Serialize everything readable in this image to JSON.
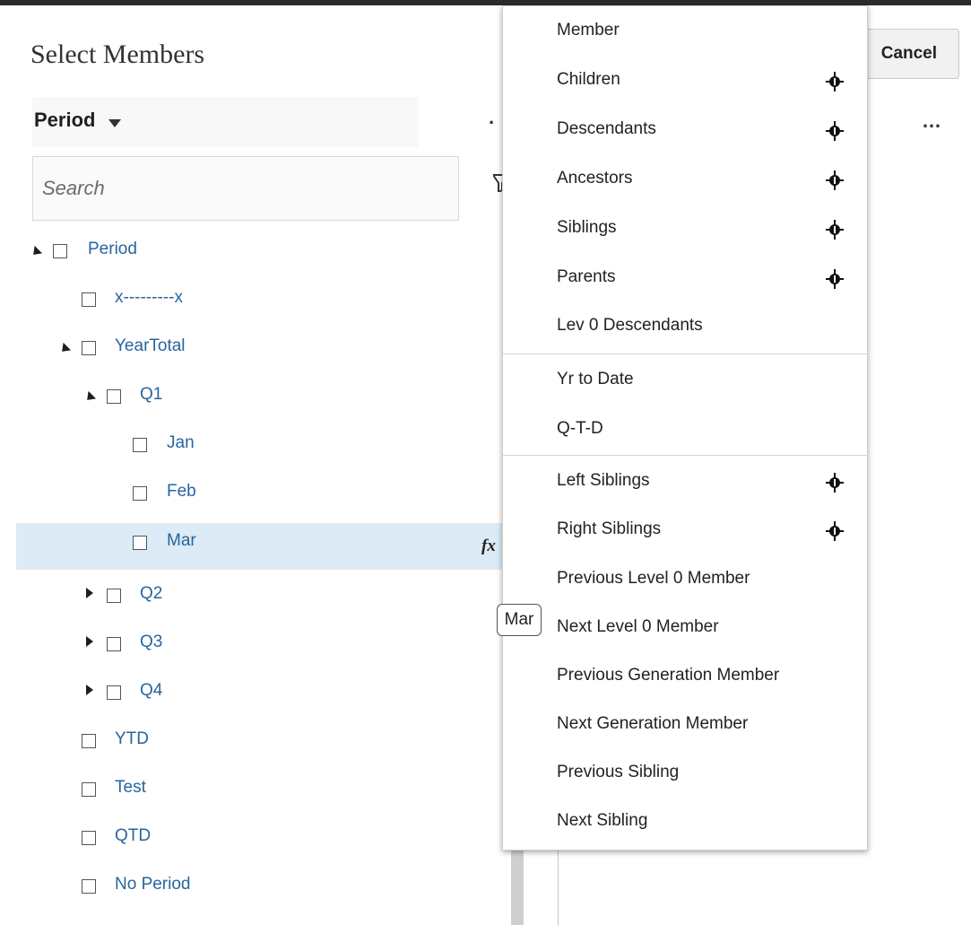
{
  "header": {
    "title": "Select Members"
  },
  "dimension": {
    "label": "Period"
  },
  "search": {
    "placeholder": "Search"
  },
  "tree": [
    {
      "label": "Period",
      "expanded": true
    },
    {
      "label": "x---------x"
    },
    {
      "label": "YearTotal",
      "expanded": true
    },
    {
      "label": "Q1",
      "expanded": true
    },
    {
      "label": "Jan"
    },
    {
      "label": "Feb"
    },
    {
      "label": "Mar",
      "selected": true
    },
    {
      "label": "Q2",
      "expanded": false
    },
    {
      "label": "Q3",
      "expanded": false
    },
    {
      "label": "Q4",
      "expanded": false
    },
    {
      "label": "YTD"
    },
    {
      "label": "Test"
    },
    {
      "label": "QTD"
    },
    {
      "label": "No Period"
    }
  ],
  "function_icon": "fx",
  "cancel_label": "Cancel",
  "more_icon": "…",
  "menu": {
    "items": [
      {
        "label": "Member",
        "icon": false
      },
      {
        "label": "Children",
        "icon": true
      },
      {
        "label": "Descendants",
        "icon": true
      },
      {
        "label": "Ancestors",
        "icon": true
      },
      {
        "label": "Siblings",
        "icon": true
      },
      {
        "label": "Parents",
        "icon": true
      },
      {
        "label": "Lev 0 Descendants",
        "icon": false
      },
      {
        "label": "Yr to Date",
        "icon": false
      },
      {
        "label": "Q-T-D",
        "icon": false
      },
      {
        "label": "Left Siblings",
        "icon": true
      },
      {
        "label": "Right Siblings",
        "icon": true
      },
      {
        "label": "Previous Level 0 Member",
        "icon": false
      },
      {
        "label": "Next Level 0 Member",
        "icon": false
      },
      {
        "label": "Previous Generation Member",
        "icon": false
      },
      {
        "label": "Next Generation Member",
        "icon": false
      },
      {
        "label": "Previous Sibling",
        "icon": false
      },
      {
        "label": "Next Sibling",
        "icon": false
      }
    ]
  },
  "tooltip": "Mar"
}
